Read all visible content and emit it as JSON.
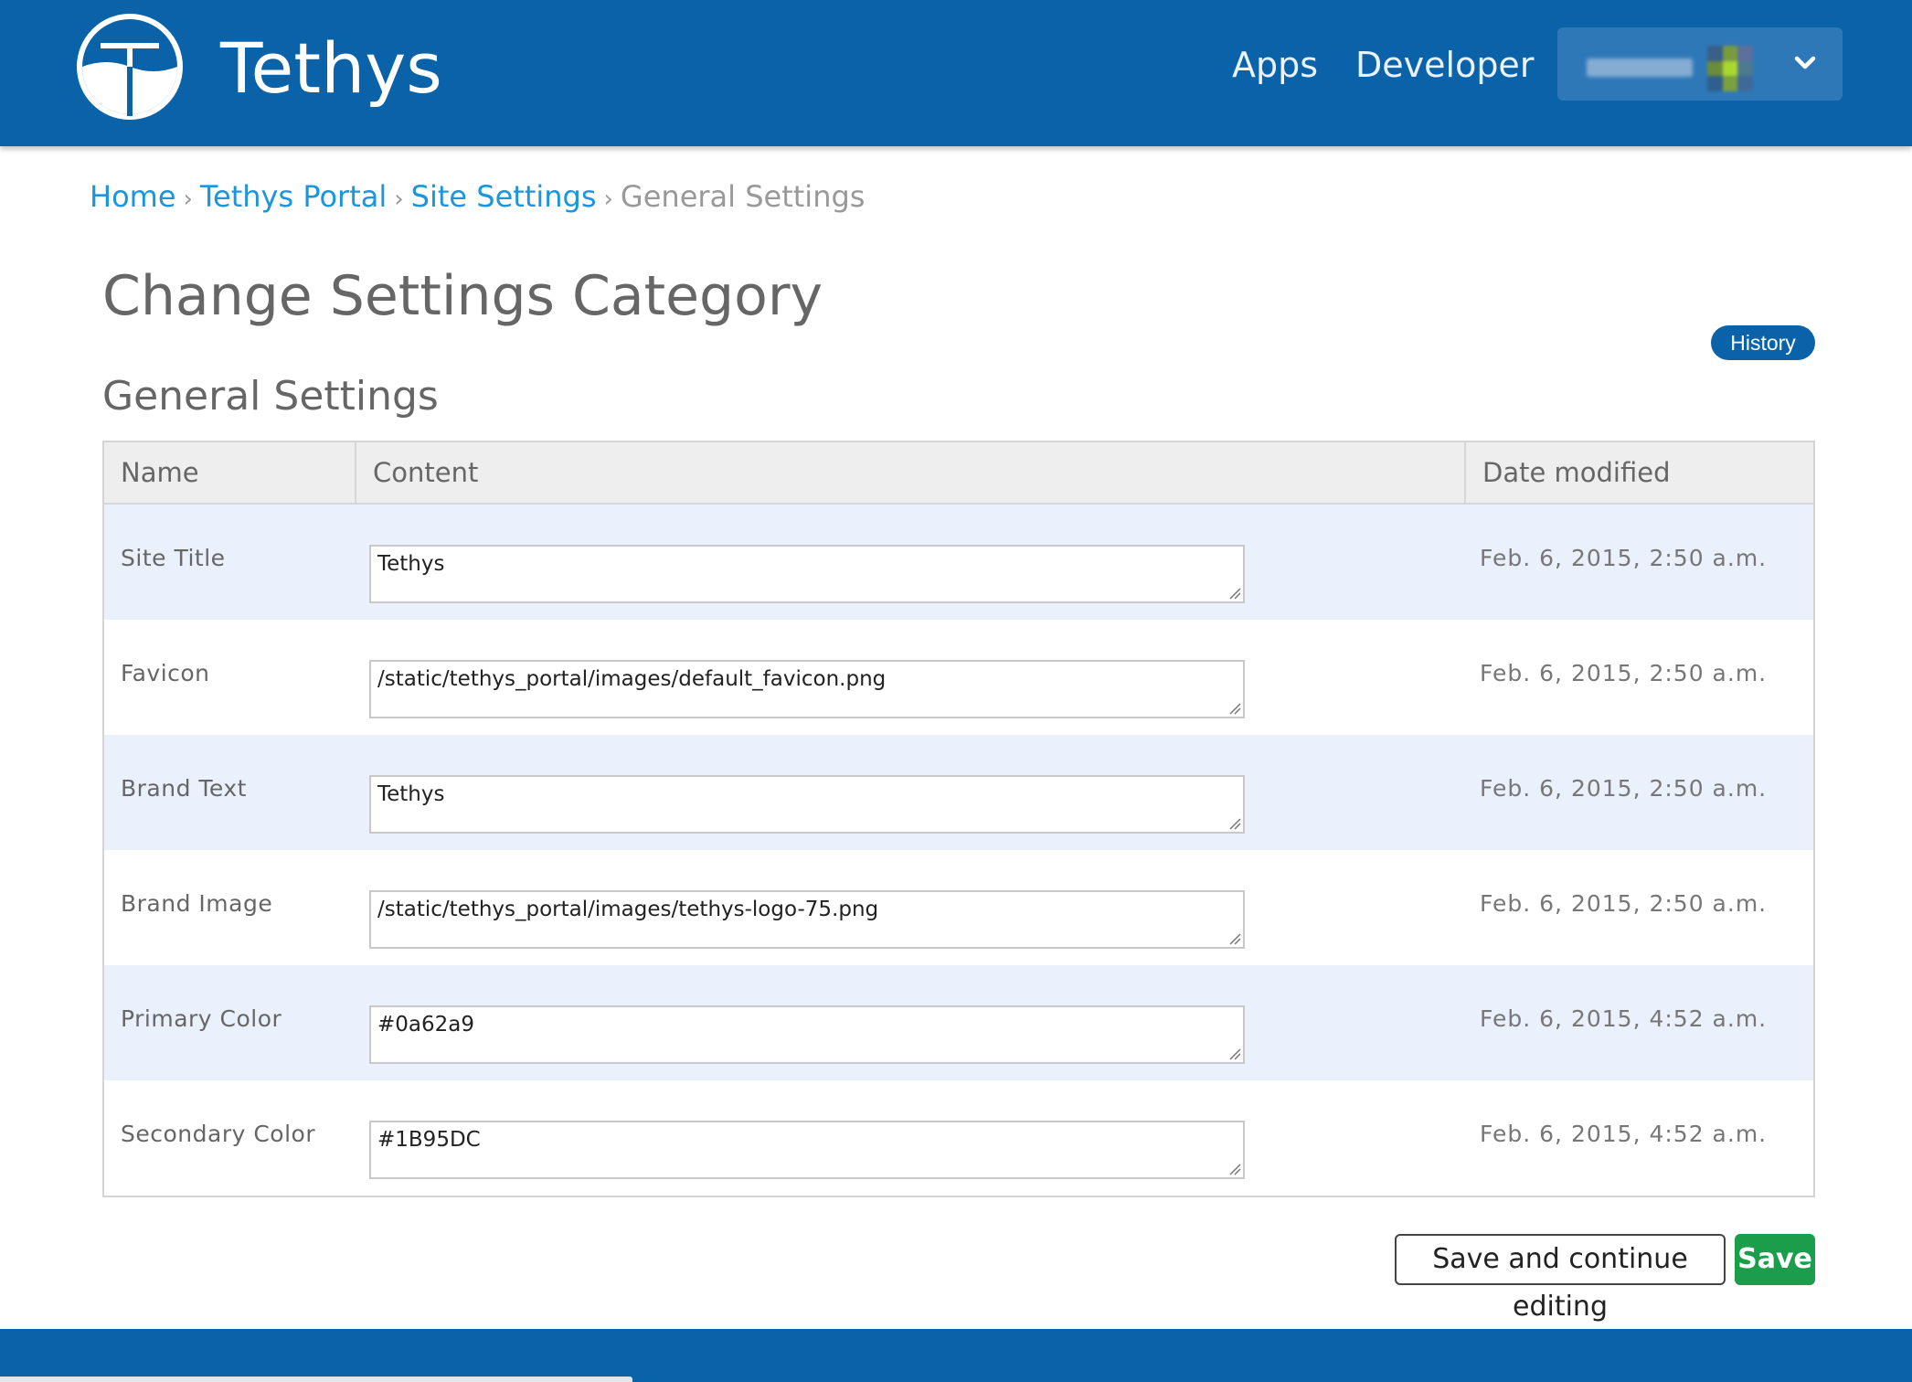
{
  "navbar": {
    "brand_text": "Tethys",
    "links": [
      {
        "label": "Apps"
      },
      {
        "label": "Developer"
      }
    ],
    "user_menu": {
      "avatar_colors": [
        "#3a5f8a",
        "#7a9a40",
        "#5d6f9c",
        "#6b8c3a",
        "#a8d830",
        "#4d7a8e",
        "#2f5f8f",
        "#7aa040",
        "#3d6a9a"
      ]
    }
  },
  "breadcrumb": {
    "items": [
      {
        "label": "Home"
      },
      {
        "label": "Tethys Portal"
      },
      {
        "label": "Site Settings"
      }
    ],
    "separator": "›",
    "current": "General Settings"
  },
  "page": {
    "title": "Change Settings Category",
    "history_label": "History",
    "section_title": "General Settings"
  },
  "table": {
    "headers": {
      "name": "Name",
      "content": "Content",
      "date": "Date modified"
    },
    "rows": [
      {
        "name": "Site Title",
        "value": "Tethys",
        "date": "Feb. 6, 2015, 2:50 a.m."
      },
      {
        "name": "Favicon",
        "value": "/static/tethys_portal/images/default_favicon.png",
        "date": "Feb. 6, 2015, 2:50 a.m."
      },
      {
        "name": "Brand Text",
        "value": "Tethys",
        "date": "Feb. 6, 2015, 2:50 a.m."
      },
      {
        "name": "Brand Image",
        "value": "/static/tethys_portal/images/tethys-logo-75.png",
        "date": "Feb. 6, 2015, 2:50 a.m."
      },
      {
        "name": "Primary Color",
        "value": "#0a62a9",
        "date": "Feb. 6, 2015, 4:52 a.m."
      },
      {
        "name": "Secondary Color",
        "value": "#1B95DC",
        "date": "Feb. 6, 2015, 4:52 a.m."
      }
    ]
  },
  "actions": {
    "save_continue_label": "Save and continue editing",
    "save_label": "Save"
  },
  "colors": {
    "primary": "#0a62a9",
    "secondary": "#1B95DC",
    "save_green": "#1a9e4b",
    "row_alt": "#eaf1fc"
  }
}
